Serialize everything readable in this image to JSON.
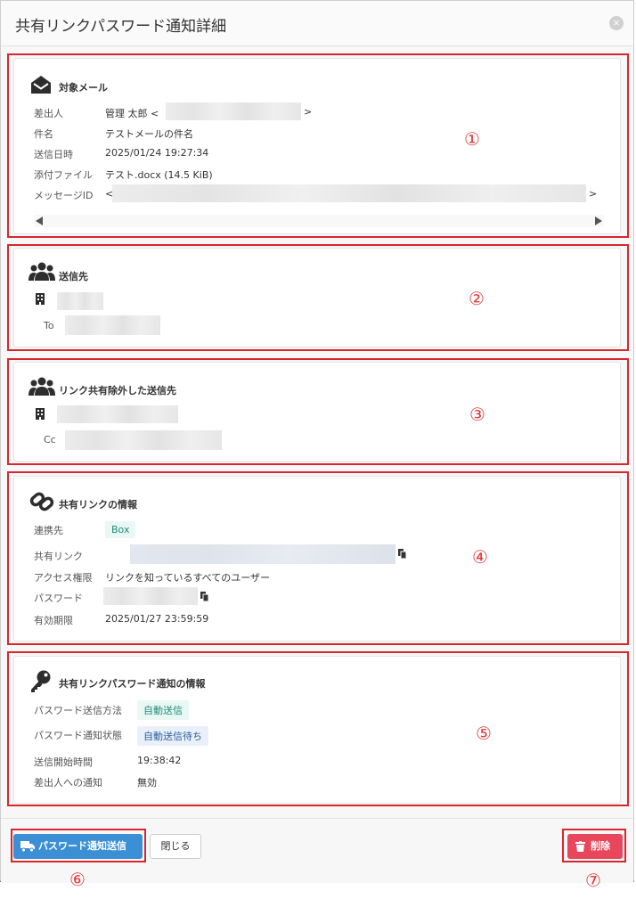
{
  "dialog": {
    "title": "共有リンクパスワード通知詳細",
    "close_icon": "×"
  },
  "target_mail": {
    "title": "対象メール",
    "sender_label": "差出人",
    "sender_name": "管理 太郎 <",
    "sender_end": ">",
    "subject_label": "件名",
    "subject": "テストメールの件名",
    "sent_label": "送信日時",
    "sent_at": "2025/01/24 19:27:34",
    "attachment_label": "添付ファイル",
    "attachment": "テスト.docx (14.5 KiB)",
    "message_id_label": "メッセージID",
    "message_id_start": "<",
    "message_id_end": ">"
  },
  "recipients": {
    "title": "送信先",
    "to_label": "To"
  },
  "excluded": {
    "title": "リンク共有除外した送信先",
    "cc_label": "Cc"
  },
  "share_link": {
    "title": "共有リンクの情報",
    "service_label": "連携先",
    "service": "Box",
    "link_label": "共有リンク",
    "access_label": "アクセス権限",
    "access": "リンクを知っているすべてのユーザー",
    "password_label": "パスワード",
    "expiry_label": "有効期限",
    "expiry": "2025/01/27 23:59:59"
  },
  "notification": {
    "title": "共有リンクパスワード通知の情報",
    "method_label": "パスワード送信方法",
    "method": "自動送信",
    "status_label": "パスワード通知状態",
    "status": "自動送信待ち",
    "start_label": "送信開始時間",
    "start_time": "19:38:42",
    "sender_notify_label": "差出人への通知",
    "sender_notify": "無効"
  },
  "footer": {
    "send_button": "パスワード通知送信",
    "close_button": "閉じる",
    "delete_button": "削除"
  },
  "markers": [
    "①",
    "②",
    "③",
    "④",
    "⑤",
    "⑥",
    "⑦"
  ],
  "colors": {
    "primary": "#3b8fd4",
    "danger": "#e8465a",
    "highlight": "#d9262e"
  }
}
